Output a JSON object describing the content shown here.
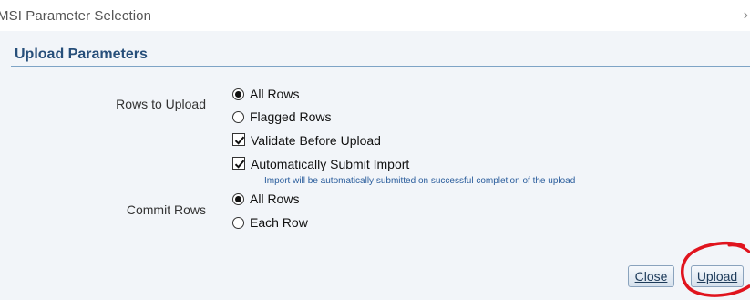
{
  "window": {
    "title": "MSI Parameter Selection",
    "chevron": "›"
  },
  "section": {
    "header": "Upload Parameters"
  },
  "rows_to_upload": {
    "label": "Rows to Upload",
    "options": [
      {
        "label": "All Rows",
        "checked": true
      },
      {
        "label": "Flagged Rows",
        "checked": false
      }
    ]
  },
  "checkboxes": [
    {
      "label": "Validate Before Upload",
      "checked": true
    },
    {
      "label": "Automatically Submit Import",
      "checked": true
    }
  ],
  "hint_text": "Import will be automatically submitted on successful completion of the upload",
  "commit_rows": {
    "label": "Commit Rows",
    "options": [
      {
        "label": "All Rows",
        "checked": true
      },
      {
        "label": "Each Row",
        "checked": false
      }
    ]
  },
  "buttons": {
    "close": "Close",
    "upload": "Upload"
  },
  "colors": {
    "header": "#274f7a",
    "annotation_circle": "#e0141e"
  },
  "icons": [
    "chevron-right-icon",
    "radio-icon",
    "checkbox-check-icon"
  ]
}
